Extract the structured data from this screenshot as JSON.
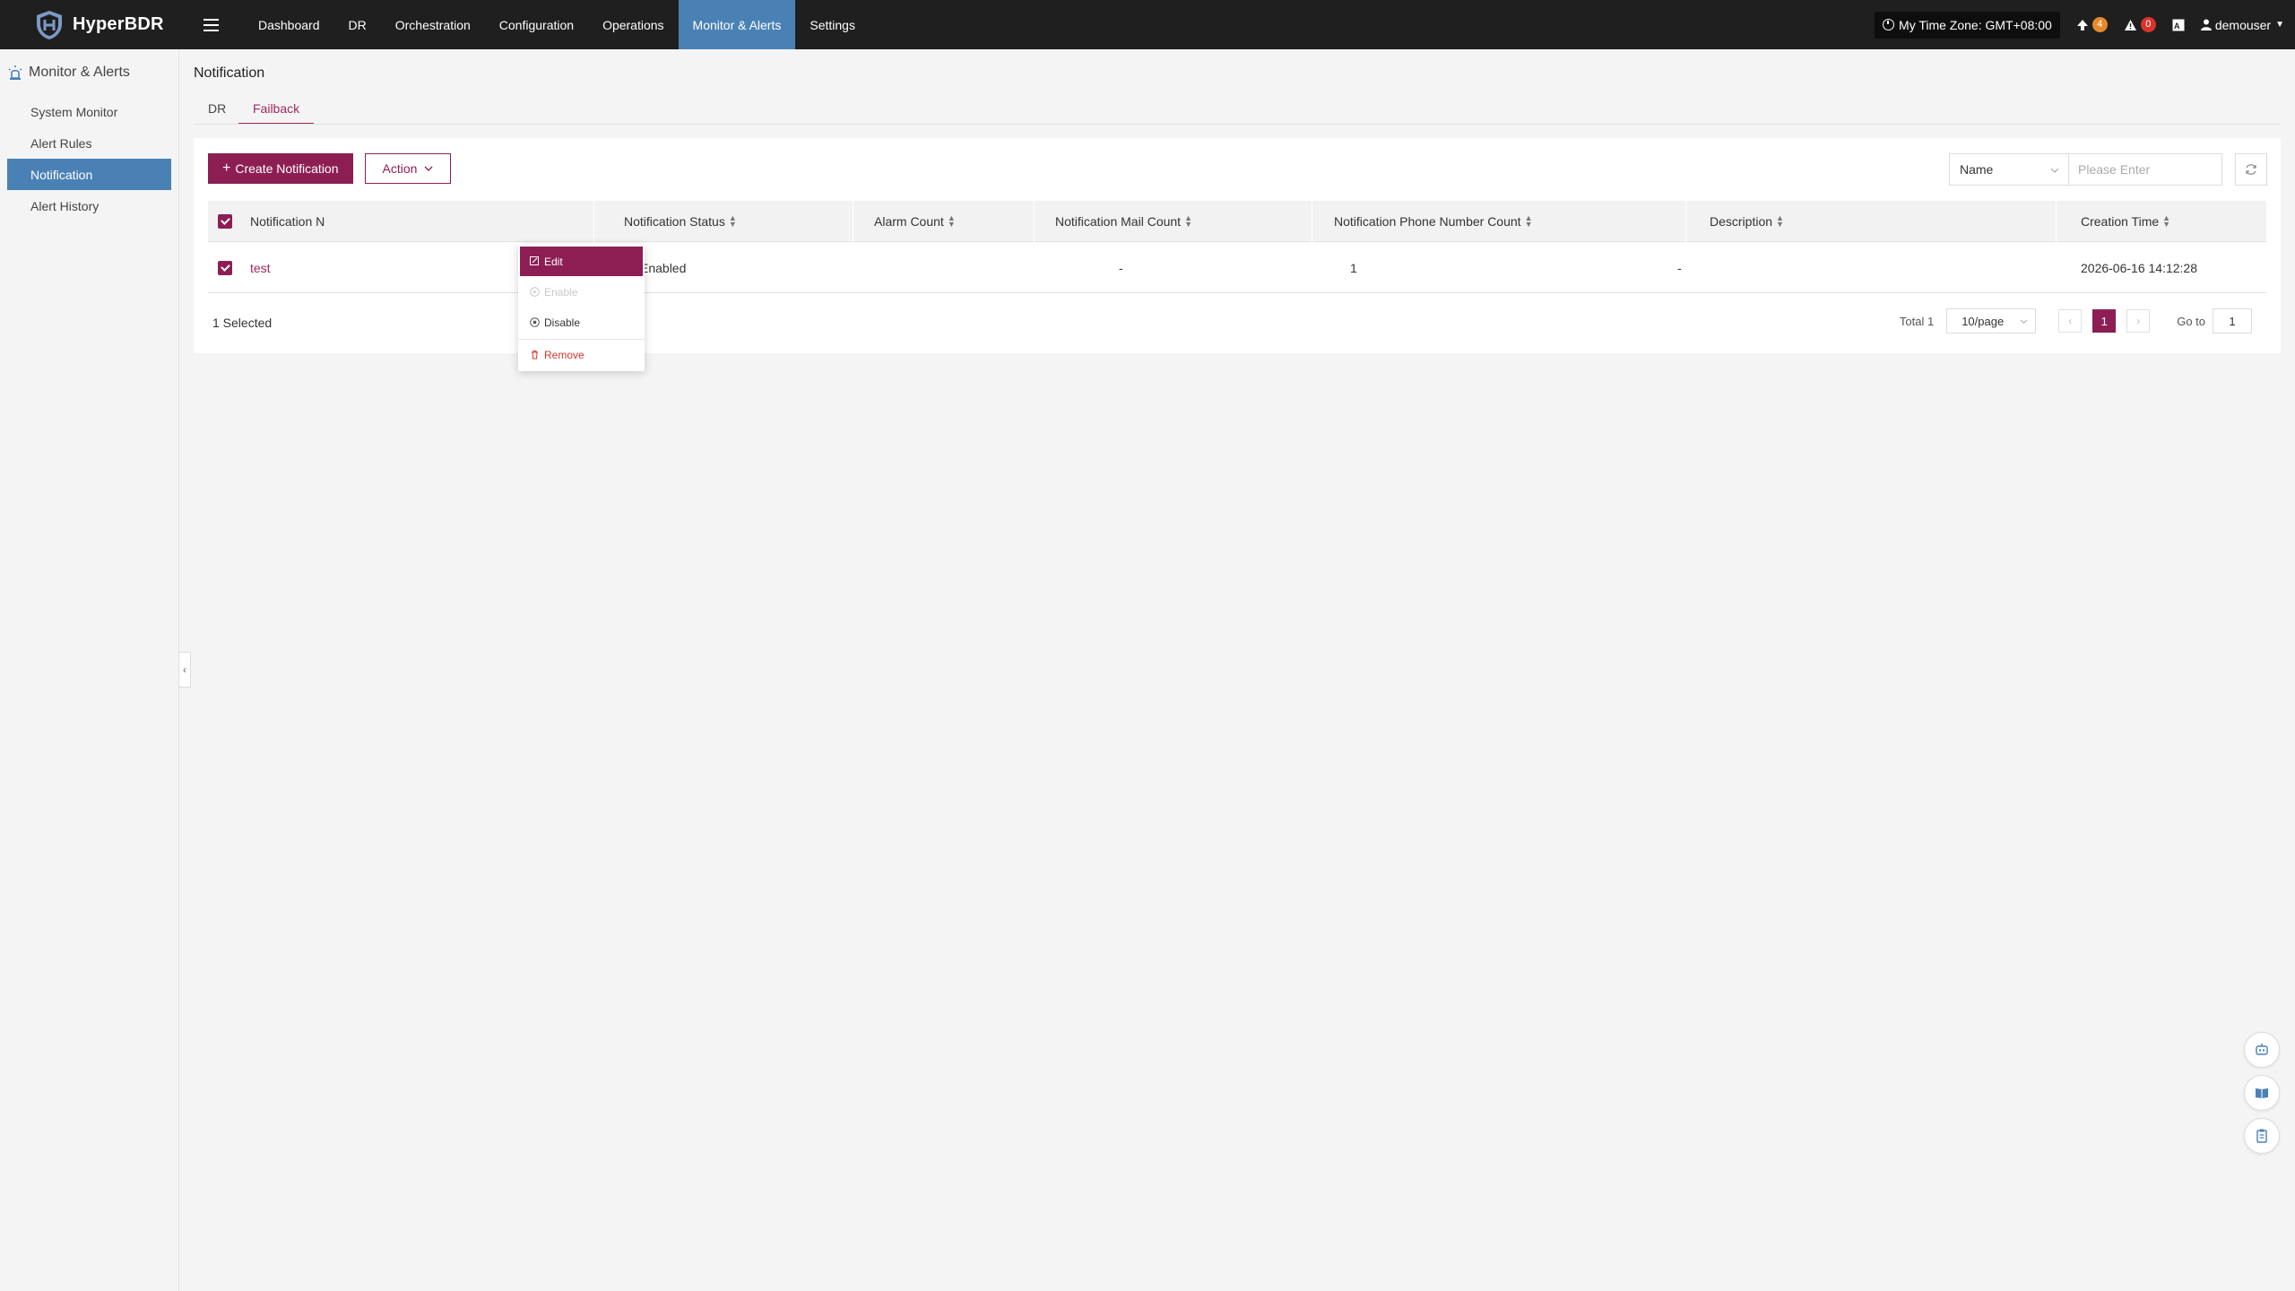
{
  "app": {
    "name": "HyperBDR",
    "nav": [
      "Dashboard",
      "DR",
      "Orchestration",
      "Configuration",
      "Operations",
      "Monitor & Alerts",
      "Settings"
    ],
    "active_nav": "Monitor & Alerts",
    "timezone": "My Time Zone: GMT+08:00",
    "upgrade_count": "4",
    "alert_count": "0",
    "user": "demouser"
  },
  "colors": {
    "brand": "#8d1e54",
    "active_nav": "#4a81b5",
    "topbar": "#1f1f1f",
    "status_enabled": "#3bae58"
  },
  "sidebar": {
    "section": "Monitor & Alerts",
    "items": [
      "System Monitor",
      "Alert Rules",
      "Notification",
      "Alert History"
    ],
    "active": "Notification"
  },
  "page": {
    "title": "Notification",
    "tabs": [
      "DR",
      "Failback"
    ],
    "active_tab": "Failback"
  },
  "toolbar": {
    "create_label": "Create Notification",
    "action_label": "Action",
    "search_field": "Name",
    "search_placeholder": "Please Enter"
  },
  "action_menu": {
    "items": [
      {
        "label": "Edit",
        "icon": "edit-icon",
        "state": "hover"
      },
      {
        "label": "Enable",
        "icon": "play-circle-icon",
        "state": "disabled"
      },
      {
        "label": "Disable",
        "icon": "stop-circle-icon",
        "state": "normal"
      },
      {
        "label": "Remove",
        "icon": "trash-icon",
        "state": "danger"
      }
    ]
  },
  "table": {
    "columns": [
      "Notification Name",
      "Notification Status",
      "Alarm Count",
      "Notification Mail Count",
      "Notification Phone Number Count",
      "Description",
      "Creation Time"
    ],
    "header_visible_name": "Notification N",
    "rows": [
      {
        "name": "test",
        "status": "Enabled",
        "alarm_count": "-",
        "mail_count": "1",
        "phone_count": "-",
        "description": "",
        "creation_time": "2026-06-16 14:12:28",
        "selected": true
      }
    ]
  },
  "footer": {
    "selected_text": "1 Selected",
    "total_text": "Total 1",
    "page_size": "10/page",
    "current_page": "1",
    "goto_label": "Go to",
    "goto_value": "1"
  }
}
